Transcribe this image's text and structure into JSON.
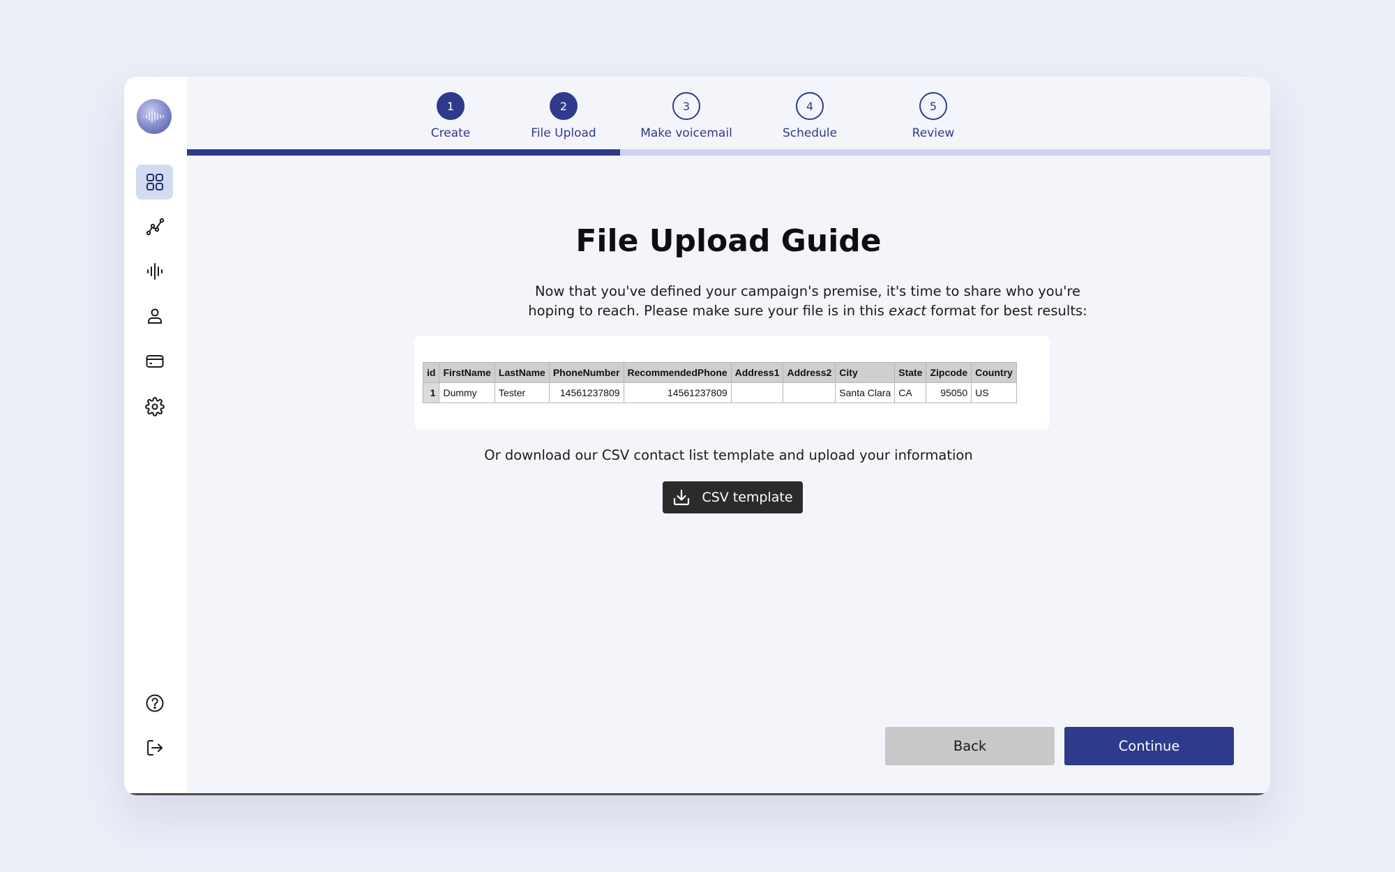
{
  "steps": [
    {
      "number": "1",
      "label": "Create",
      "done": true
    },
    {
      "number": "2",
      "label": "File Upload",
      "done": true
    },
    {
      "number": "3",
      "label": "Make voicemail",
      "done": false
    },
    {
      "number": "4",
      "label": "Schedule",
      "done": false
    },
    {
      "number": "5",
      "label": "Review",
      "done": false
    }
  ],
  "progress_fraction": 0.4,
  "sidebar": {
    "items": [
      {
        "name": "dashboard",
        "icon": "grid-icon",
        "active": true
      },
      {
        "name": "analytics",
        "icon": "graph-icon",
        "active": false
      },
      {
        "name": "voicemail",
        "icon": "audio-wave-icon",
        "active": false
      },
      {
        "name": "contacts",
        "icon": "user-icon",
        "active": false
      },
      {
        "name": "billing",
        "icon": "credit-card-icon",
        "active": false
      },
      {
        "name": "settings",
        "icon": "gear-icon",
        "active": false
      }
    ],
    "bottom": [
      {
        "name": "help",
        "icon": "help-icon"
      },
      {
        "name": "logout",
        "icon": "logout-icon"
      }
    ]
  },
  "main": {
    "title": "File Upload Guide",
    "description_line1": "Now that you've defined your campaign's premise, it's time to share who you're",
    "description_line2_before": "hoping to reach. Please make sure your file is in this ",
    "description_line2_emph": "exact",
    "description_line2_after": " format for best results:",
    "download_text": "Or download our CSV contact list template and upload your information",
    "csv_button_label": "CSV template"
  },
  "sample_table": {
    "headers": [
      "id",
      "FirstName",
      "LastName",
      "PhoneNumber",
      "RecommendedPhone",
      "Address1",
      "Address2",
      "City",
      "State",
      "Zipcode",
      "Country"
    ],
    "row": [
      "1",
      "Dummy",
      "Tester",
      "14561237809",
      "14561237809",
      "",
      "",
      "Santa Clara",
      "CA",
      "95050",
      "US"
    ]
  },
  "buttons": {
    "back": "Back",
    "continue": "Continue"
  },
  "colors": {
    "accent": "#2e3a8c",
    "progress_track": "#cdd3ef",
    "active_nav": "#d3dbf3",
    "csv_button": "#2b2b2b",
    "back_button": "#c8c8c8"
  }
}
